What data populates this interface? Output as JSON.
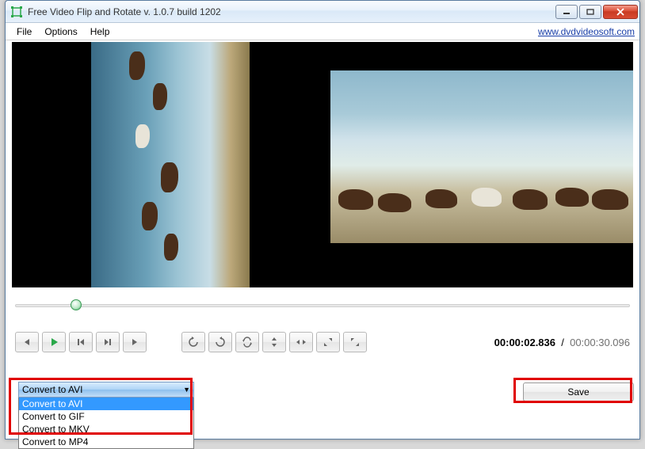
{
  "titlebar": {
    "title": "Free Video Flip and Rotate v. 1.0.7 build 1202"
  },
  "menu": {
    "file": "File",
    "options": "Options",
    "help": "Help",
    "url": "www.dvdvideosoft.com"
  },
  "time": {
    "current": "00:00:02.836",
    "sep": "/",
    "total": "00:00:30.096"
  },
  "format": {
    "selected": "Convert to AVI",
    "options": [
      "Convert to AVI",
      "Convert to GIF",
      "Convert to MKV",
      "Convert to MP4"
    ]
  },
  "save": {
    "label": "Save"
  }
}
